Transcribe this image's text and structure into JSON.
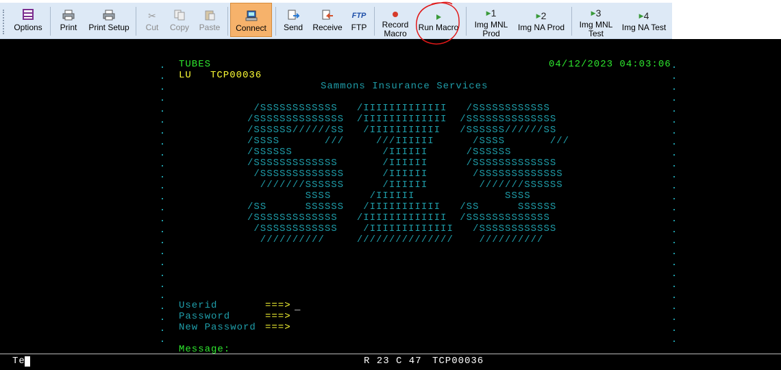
{
  "toolbar": {
    "items": [
      {
        "label": "Options",
        "icon": "options-icon"
      },
      {
        "label": "Print",
        "icon": "printer-icon"
      },
      {
        "label": "Print Setup",
        "icon": "print-setup-icon"
      },
      {
        "label": "Cut",
        "icon": "scissors-icon"
      },
      {
        "label": "Copy",
        "icon": "copy-icon"
      },
      {
        "label": "Paste",
        "icon": "paste-icon"
      },
      {
        "label": "Connect",
        "icon": "connect-icon"
      },
      {
        "label": "Send",
        "icon": "send-icon"
      },
      {
        "label": "Receive",
        "icon": "receive-icon"
      },
      {
        "label": "FTP",
        "icon": "ftp-icon"
      },
      {
        "label": "Record",
        "label2": "Macro",
        "icon": "record-icon"
      },
      {
        "label": "Run Macro",
        "icon": "play-icon"
      },
      {
        "label": "Img MNL",
        "label2": "Prod",
        "glyph": "1"
      },
      {
        "label": "Img NA Prod",
        "glyph": "2"
      },
      {
        "label": "Img MNL",
        "label2": "Test",
        "glyph": "3"
      },
      {
        "label": "Img NA Test",
        "glyph": "4"
      }
    ]
  },
  "screen": {
    "app_name": "TUBES",
    "lu_label": "LU",
    "lu_value": "TCP00036",
    "datetime": "04/12/2023 04:03:06",
    "company": "Sammons Insurance Services",
    "logo_lines": [
      " /SSSSSSSSSSSS   /IIIIIIIIIIIII   /SSSSSSSSSSSS",
      "/SSSSSSSSSSSSSS  /IIIIIIIIIIIII  /SSSSSSSSSSSSSS",
      "/SSSSSS//////SS   /IIIIIIIIIII   /SSSSSS//////SS",
      "/SSSS       ///     ///IIIIII      /SSSS       ///",
      "/SSSSSS              /IIIIII      /SSSSSS",
      "/SSSSSSSSSSSSS       /IIIIII      /SSSSSSSSSSSSS",
      " /SSSSSSSSSSSSS      /IIIIII       /SSSSSSSSSSSSS",
      "  ///////SSSSSS      /IIIIII        ///////SSSSSS",
      "         SSSS      /IIIIII              SSSS",
      "/SS      SSSSSS   /IIIIIIIIIII   /SS      SSSSSS",
      "/SSSSSSSSSSSSS   /IIIIIIIIIIIII  /SSSSSSSSSSSSS",
      " /SSSSSSSSSSSS    /IIIIIIIIIIIII   /SSSSSSSSSSSS",
      "  //////////     ///////////////    //////////"
    ],
    "fields": [
      {
        "label": "Userid",
        "arrow": "===>"
      },
      {
        "label": "Password",
        "arrow": "===>"
      },
      {
        "label": "New Password",
        "arrow": "===>"
      }
    ],
    "cursor": "_",
    "message_label": "Message:"
  },
  "status": {
    "left_text": "Te",
    "position": "R 23 C 47",
    "session": "TCP00036"
  }
}
